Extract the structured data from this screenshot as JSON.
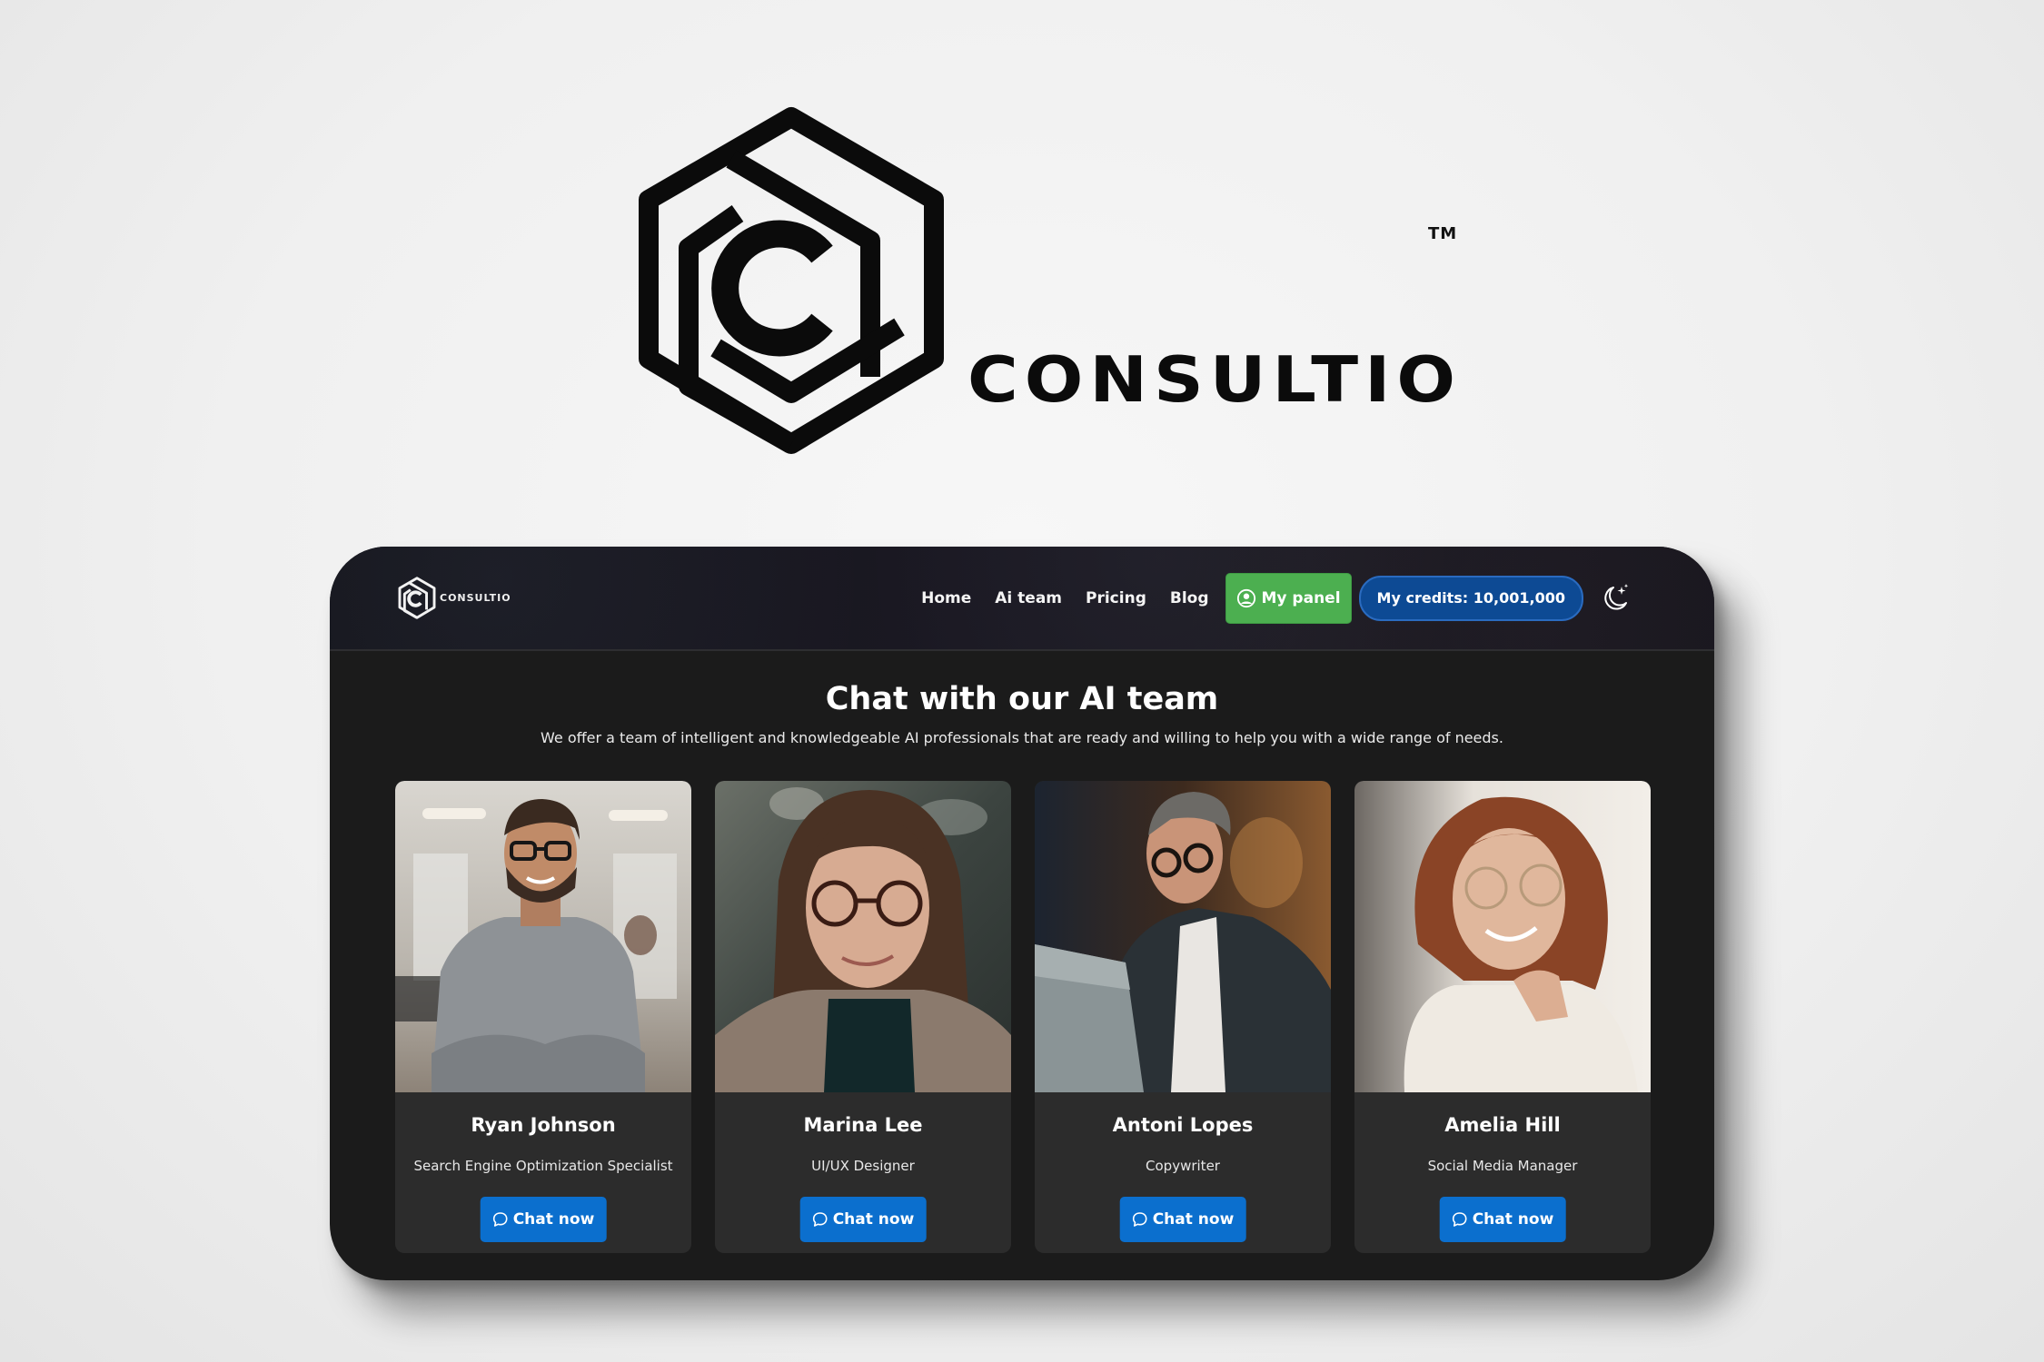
{
  "brand": {
    "wordmark": "CONSULTIO",
    "trademark": "TM"
  },
  "header": {
    "logo_text": "CONSULTIO",
    "nav": [
      {
        "label": "Home"
      },
      {
        "label": "Ai team"
      },
      {
        "label": "Pricing"
      },
      {
        "label": "Blog"
      }
    ],
    "panel_button": {
      "label": "My panel",
      "icon": "user-circle-icon",
      "color": "#4caf50"
    },
    "credits_button": {
      "label": "My credits: 10,001,000",
      "color": "#0d4a94"
    },
    "theme_toggle_icon": "moon-stars-icon"
  },
  "hero": {
    "title": "Chat with our AI team",
    "subtitle": "We offer a team of intelligent and knowledgeable AI professionals that are ready and willing to help you with a wide range of needs."
  },
  "team": [
    {
      "name": "Ryan Johnson",
      "role": "Search Engine Optimization Specialist",
      "button": "Chat now"
    },
    {
      "name": "Marina Lee",
      "role": "UI/UX Designer",
      "button": "Chat now"
    },
    {
      "name": "Antoni Lopes",
      "role": "Copywriter",
      "button": "Chat now"
    },
    {
      "name": "Amelia Hill",
      "role": "Social Media Manager",
      "button": "Chat now"
    }
  ],
  "colors": {
    "accent_blue": "#0b6fce",
    "panel_green": "#4caf50",
    "background_dark": "#1b1b1b",
    "card": "#2c2c2c"
  }
}
